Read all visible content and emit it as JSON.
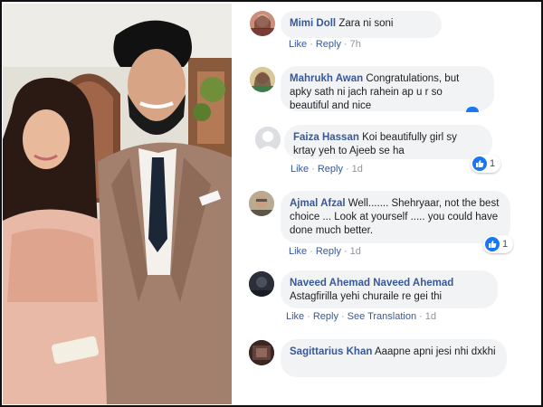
{
  "comments": [
    {
      "name": "Mimi Doll",
      "text": "Zara ni soni",
      "actions": {
        "like": "Like",
        "reply": "Reply",
        "time": "7h"
      }
    },
    {
      "name": "Mahrukh Awan",
      "text": "Congratulations, but apky sath ni jach rahein ap u r so beautiful and nice"
    },
    {
      "name": "Faiza Hassan",
      "text": "Koi beautifully girl sy krtay yeh to Ajeeb se ha",
      "actions": {
        "like": "Like",
        "reply": "Reply",
        "time": "1d"
      },
      "reactions": "1"
    },
    {
      "name": "Ajmal Afzal",
      "text": "Well....... Shehryaar, not the best choice ... Look at yourself ..... you could have done much better.",
      "actions": {
        "like": "Like",
        "reply": "Reply",
        "time": "1d"
      },
      "reactions": "1"
    },
    {
      "name": "Naveed Ahemad Naveed Ahemad",
      "text": "Astagfirilla yehi churaile re gei thi",
      "actions": {
        "like": "Like",
        "reply": "Reply",
        "translate": "See Translation",
        "time": "1d"
      }
    },
    {
      "name": "Sagittarius Khan",
      "text": "Aaapne apni jesi nhi dxkhi"
    }
  ],
  "colors": {
    "name": "#385898",
    "bubble": "#f2f3f5",
    "like_blue": "#1877f2",
    "text": "#1c1e21",
    "muted": "#90949c"
  }
}
